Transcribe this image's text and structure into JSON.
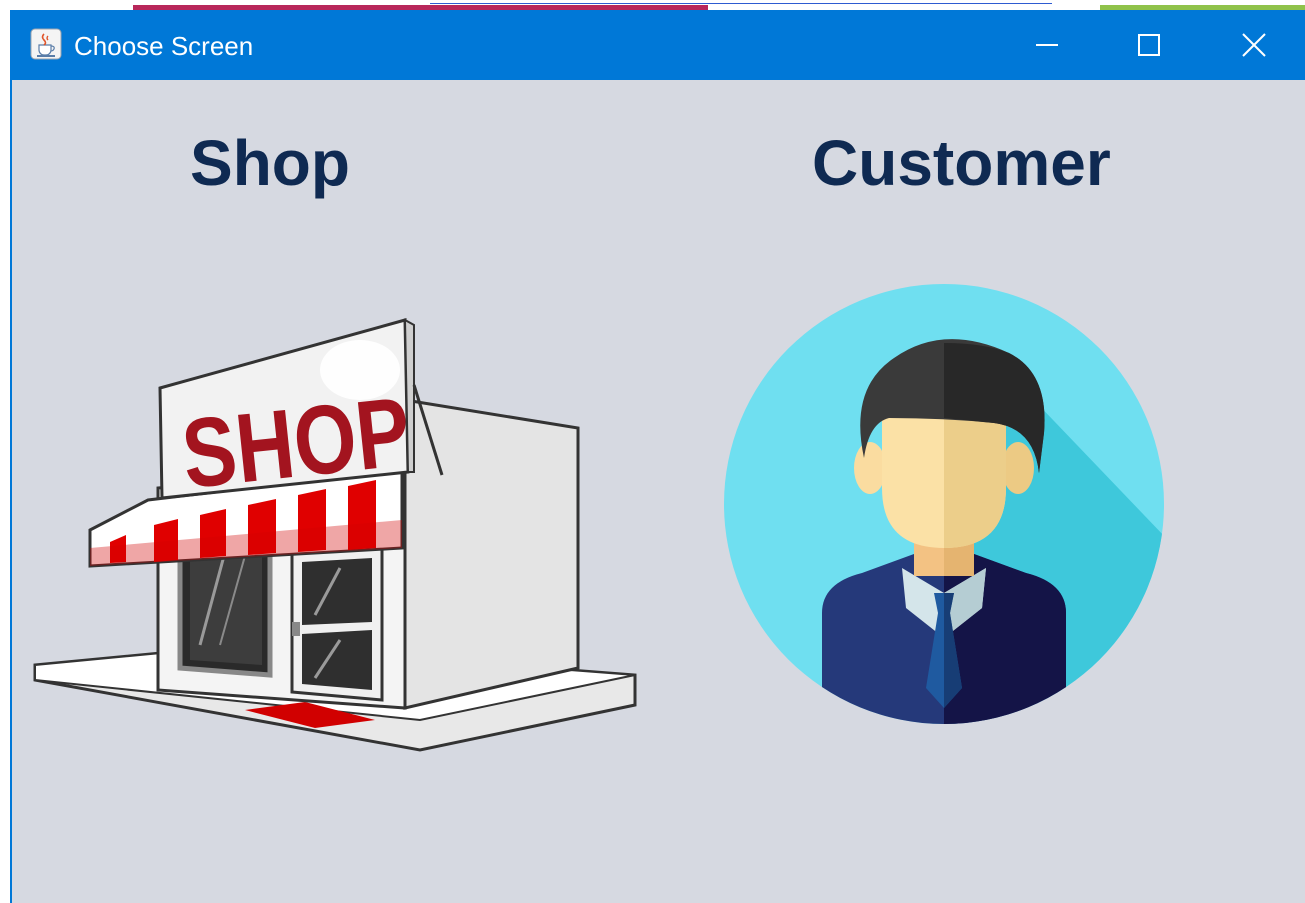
{
  "window": {
    "title": "Choose Screen",
    "app_icon": "java-cup-icon",
    "controls": [
      "minimize-icon",
      "maximize-icon",
      "close-icon"
    ]
  },
  "options": [
    {
      "label": "Shop",
      "image": "shop-storefront-illustration",
      "sign_text": "SHOP"
    },
    {
      "label": "Customer",
      "image": "customer-avatar-illustration"
    }
  ],
  "colors": {
    "titlebar": "#0078d7",
    "background": "#d6d9e1",
    "heading": "#0f2a52",
    "avatar_circle": "#6fdff0"
  }
}
